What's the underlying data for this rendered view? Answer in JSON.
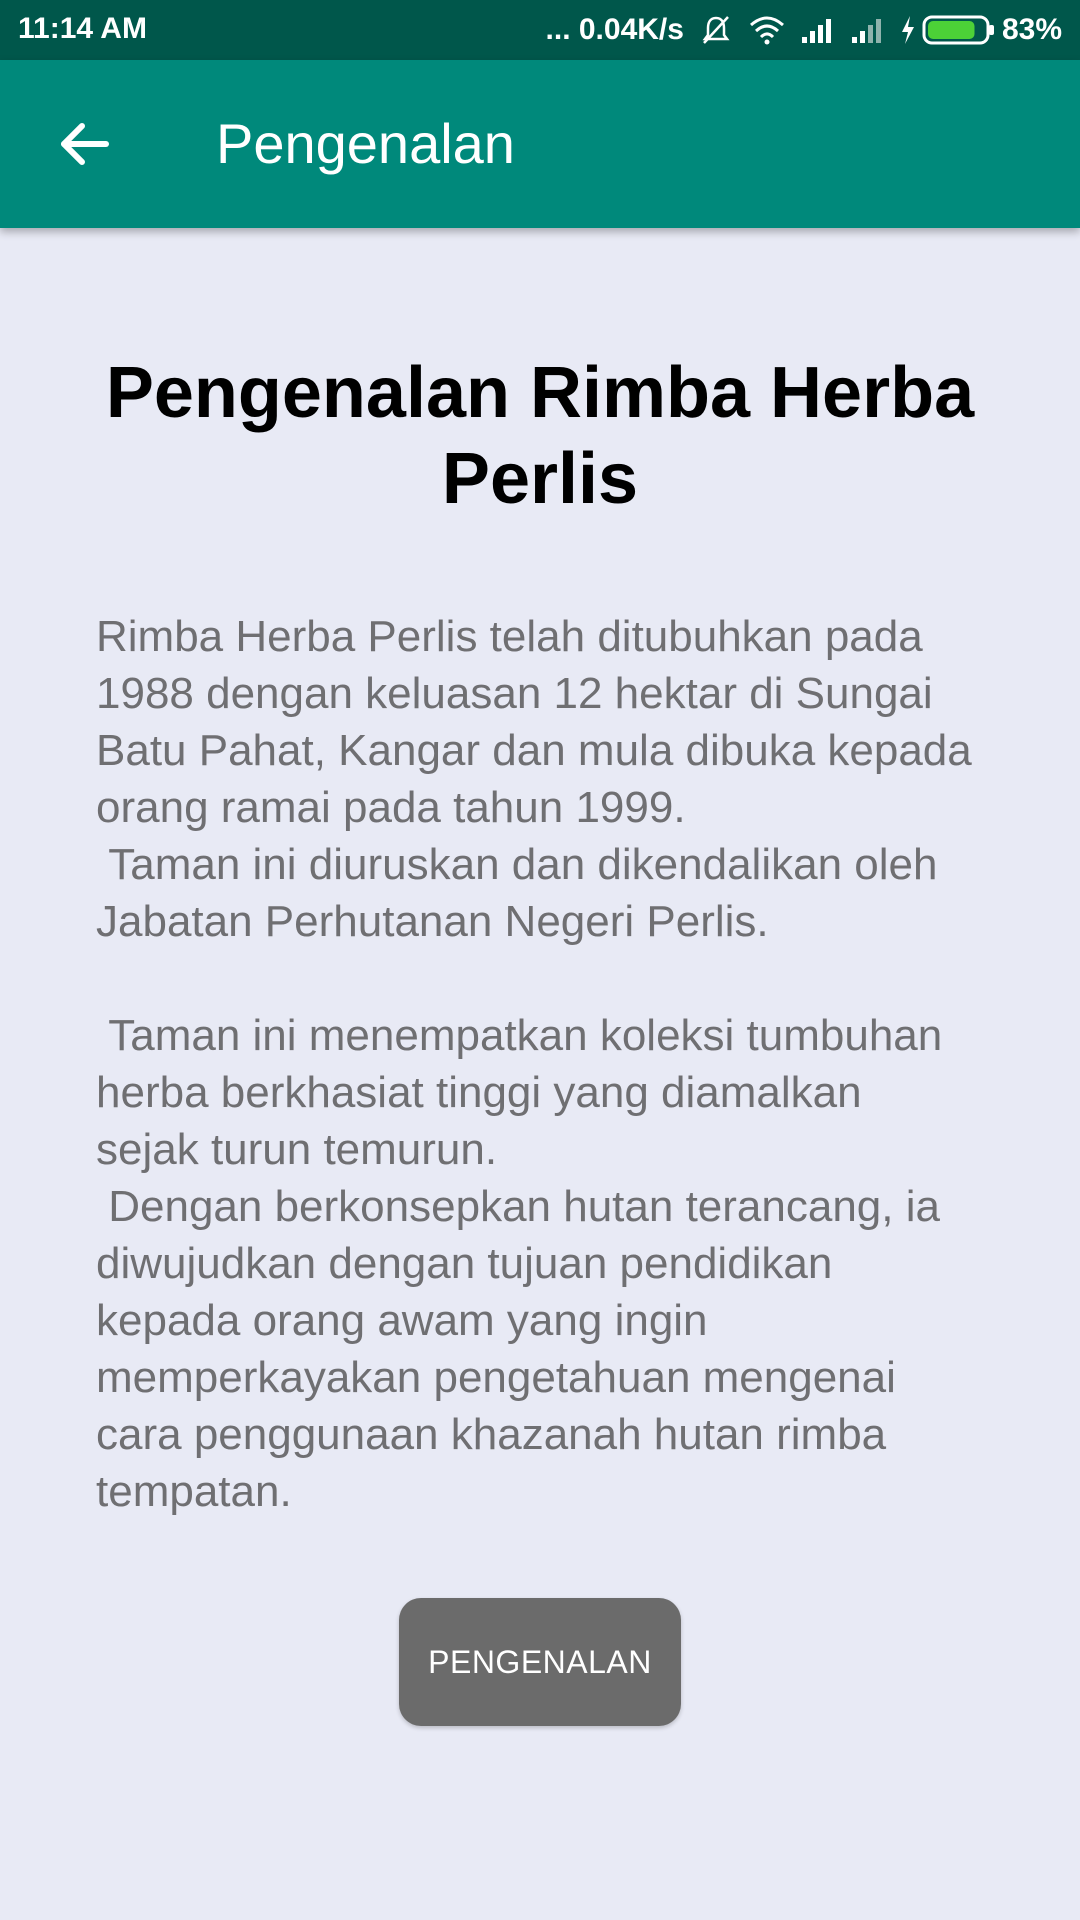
{
  "status_bar": {
    "time": "11:14 AM",
    "network_speed": "... 0.04K/s",
    "battery_percent": "83%",
    "battery_level": 0.83,
    "icons": [
      "mute-vibrate-icon",
      "wifi-icon",
      "signal-icon",
      "signal-icon",
      "charging-icon",
      "battery-icon"
    ]
  },
  "app_bar": {
    "title": "Pengenalan",
    "back_icon": "arrow-back-icon",
    "color": "#00897b"
  },
  "main": {
    "heading": "Pengenalan Rimba Herba Perlis",
    "body": "Rimba Herba Perlis telah ditubuhkan pada 1988 dengan keluasan 12 hektar di Sungai Batu Pahat, Kangar dan mula dibuka kepada orang ramai pada tahun 1999.\n Taman ini diuruskan dan dikendalikan oleh Jabatan Perhutanan Negeri Perlis.\n\n Taman ini menempatkan koleksi tumbuhan herba berkhasiat tinggi yang diamalkan sejak turun temurun.\n Dengan berkonsepkan hutan terancang, ia diwujudkan dengan tujuan pendidikan kepada orang awam yang ingin memperkayakan pengetahuan mengenai cara penggunaan khazanah hutan rimba tempatan.",
    "button_label": "PENGENALAN"
  }
}
